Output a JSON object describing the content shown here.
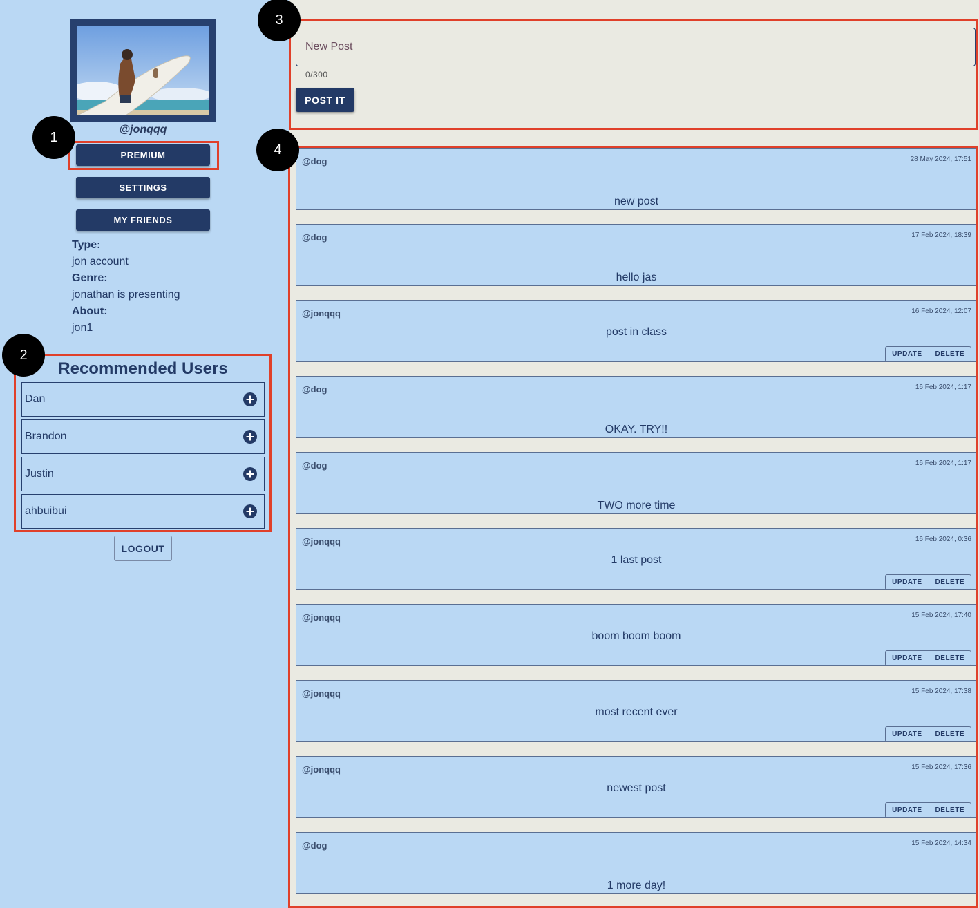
{
  "profile": {
    "username": "@jonqqq",
    "photo_alt": "",
    "buttons": {
      "premium": "PREMIUM",
      "settings": "SETTINGS",
      "friends": "MY FRIENDS"
    },
    "type_label": "Type:",
    "type_value": "jon account",
    "genre_label": "Genre:",
    "genre_value": "jonathan is presenting",
    "about_label": "About:",
    "about_value": "jon1"
  },
  "recommended": {
    "title": "Recommended Users",
    "users": [
      "Dan",
      "Brandon",
      "Justin",
      "ahbuibui"
    ],
    "add_icon": "plus-circle-icon"
  },
  "logout_label": "LOGOUT",
  "compose": {
    "placeholder": "New Post",
    "counter": "0/300",
    "submit_label": "POST IT"
  },
  "post_actions": {
    "update": "UPDATE",
    "delete": "DELETE"
  },
  "posts": [
    {
      "author": "@dog",
      "date": "28 May 2024, 17:51",
      "text": "new post",
      "own": false
    },
    {
      "author": "@dog",
      "date": "17 Feb 2024, 18:39",
      "text": "hello jas",
      "own": false
    },
    {
      "author": "@jonqqq",
      "date": "16 Feb 2024, 12:07",
      "text": "post in class",
      "own": true
    },
    {
      "author": "@dog",
      "date": "16 Feb 2024, 1:17",
      "text": "OKAY. TRY!!",
      "own": false
    },
    {
      "author": "@dog",
      "date": "16 Feb 2024, 1:17",
      "text": "TWO more time",
      "own": false
    },
    {
      "author": "@jonqqq",
      "date": "16 Feb 2024, 0:36",
      "text": "1 last post",
      "own": true
    },
    {
      "author": "@jonqqq",
      "date": "15 Feb 2024, 17:40",
      "text": "boom boom boom",
      "own": true
    },
    {
      "author": "@jonqqq",
      "date": "15 Feb 2024, 17:38",
      "text": "most recent ever",
      "own": true
    },
    {
      "author": "@jonqqq",
      "date": "15 Feb 2024, 17:36",
      "text": "newest post",
      "own": true
    },
    {
      "author": "@dog",
      "date": "15 Feb 2024, 14:34",
      "text": "1 more day!",
      "own": false
    }
  ],
  "annotations": [
    "1",
    "2",
    "3",
    "4"
  ],
  "colors": {
    "accent": "#233a66",
    "panel": "#bad8f4",
    "compose_bg": "#eaeae2",
    "highlight": "#e0402a"
  }
}
